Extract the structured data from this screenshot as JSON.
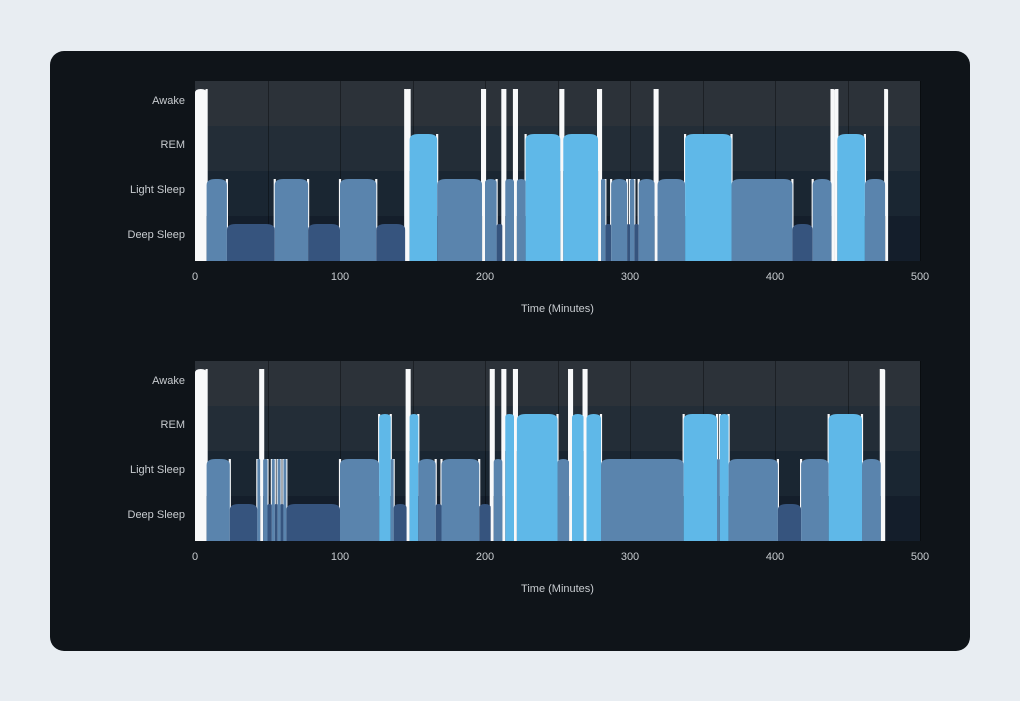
{
  "xlabel": "Time (Minutes)",
  "stages": [
    "Awake",
    "REM",
    "Light Sleep",
    "Deep Sleep"
  ],
  "xticks": [
    0,
    100,
    200,
    300,
    400,
    500
  ],
  "xmin": 0,
  "xmax": 500,
  "chart_data": [
    {
      "type": "hypnogram",
      "title": "",
      "xlabel": "Time (Minutes)",
      "ylabel": "",
      "categories": [
        "Awake",
        "REM",
        "Light Sleep",
        "Deep Sleep"
      ],
      "xlim": [
        0,
        500
      ],
      "segments": [
        {
          "start": 0,
          "end": 8,
          "stage": "Awake"
        },
        {
          "start": 8,
          "end": 22,
          "stage": "Light Sleep"
        },
        {
          "start": 22,
          "end": 55,
          "stage": "Deep Sleep"
        },
        {
          "start": 55,
          "end": 78,
          "stage": "Light Sleep"
        },
        {
          "start": 78,
          "end": 100,
          "stage": "Deep Sleep"
        },
        {
          "start": 100,
          "end": 125,
          "stage": "Light Sleep"
        },
        {
          "start": 125,
          "end": 145,
          "stage": "Deep Sleep"
        },
        {
          "start": 145,
          "end": 148,
          "stage": "Awake"
        },
        {
          "start": 148,
          "end": 167,
          "stage": "REM"
        },
        {
          "start": 167,
          "end": 198,
          "stage": "Light Sleep"
        },
        {
          "start": 198,
          "end": 200,
          "stage": "Awake"
        },
        {
          "start": 200,
          "end": 208,
          "stage": "Light Sleep"
        },
        {
          "start": 208,
          "end": 212,
          "stage": "Deep Sleep"
        },
        {
          "start": 212,
          "end": 214,
          "stage": "Awake"
        },
        {
          "start": 214,
          "end": 220,
          "stage": "Light Sleep"
        },
        {
          "start": 220,
          "end": 222,
          "stage": "Awake"
        },
        {
          "start": 222,
          "end": 228,
          "stage": "Light Sleep"
        },
        {
          "start": 228,
          "end": 252,
          "stage": "REM"
        },
        {
          "start": 252,
          "end": 254,
          "stage": "Awake"
        },
        {
          "start": 254,
          "end": 278,
          "stage": "REM"
        },
        {
          "start": 278,
          "end": 280,
          "stage": "Awake"
        },
        {
          "start": 280,
          "end": 283,
          "stage": "Light Sleep"
        },
        {
          "start": 283,
          "end": 287,
          "stage": "Deep Sleep"
        },
        {
          "start": 287,
          "end": 298,
          "stage": "Light Sleep"
        },
        {
          "start": 298,
          "end": 300,
          "stage": "Deep Sleep"
        },
        {
          "start": 300,
          "end": 303,
          "stage": "Light Sleep"
        },
        {
          "start": 303,
          "end": 306,
          "stage": "Deep Sleep"
        },
        {
          "start": 306,
          "end": 317,
          "stage": "Light Sleep"
        },
        {
          "start": 317,
          "end": 319,
          "stage": "Awake"
        },
        {
          "start": 319,
          "end": 338,
          "stage": "Light Sleep"
        },
        {
          "start": 338,
          "end": 370,
          "stage": "REM"
        },
        {
          "start": 370,
          "end": 412,
          "stage": "Light Sleep"
        },
        {
          "start": 412,
          "end": 426,
          "stage": "Deep Sleep"
        },
        {
          "start": 426,
          "end": 439,
          "stage": "Light Sleep"
        },
        {
          "start": 439,
          "end": 441,
          "stage": "Awake"
        },
        {
          "start": 441,
          "end": 443,
          "stage": "Awake"
        },
        {
          "start": 443,
          "end": 462,
          "stage": "REM"
        },
        {
          "start": 462,
          "end": 476,
          "stage": "Light Sleep"
        },
        {
          "start": 476,
          "end": 478,
          "stage": "Awake"
        }
      ]
    },
    {
      "type": "hypnogram",
      "title": "",
      "xlabel": "Time (Minutes)",
      "ylabel": "",
      "categories": [
        "Awake",
        "REM",
        "Light Sleep",
        "Deep Sleep"
      ],
      "xlim": [
        0,
        500
      ],
      "segments": [
        {
          "start": 0,
          "end": 8,
          "stage": "Awake"
        },
        {
          "start": 8,
          "end": 24,
          "stage": "Light Sleep"
        },
        {
          "start": 24,
          "end": 43,
          "stage": "Deep Sleep"
        },
        {
          "start": 43,
          "end": 45,
          "stage": "Light Sleep"
        },
        {
          "start": 45,
          "end": 47,
          "stage": "Awake"
        },
        {
          "start": 47,
          "end": 50,
          "stage": "Light Sleep"
        },
        {
          "start": 50,
          "end": 53,
          "stage": "Deep Sleep"
        },
        {
          "start": 53,
          "end": 55,
          "stage": "Light Sleep"
        },
        {
          "start": 55,
          "end": 57,
          "stage": "Deep Sleep"
        },
        {
          "start": 57,
          "end": 59,
          "stage": "Light Sleep"
        },
        {
          "start": 59,
          "end": 61,
          "stage": "Deep Sleep"
        },
        {
          "start": 61,
          "end": 63,
          "stage": "Light Sleep"
        },
        {
          "start": 63,
          "end": 100,
          "stage": "Deep Sleep"
        },
        {
          "start": 100,
          "end": 127,
          "stage": "Light Sleep"
        },
        {
          "start": 127,
          "end": 135,
          "stage": "REM"
        },
        {
          "start": 135,
          "end": 137,
          "stage": "Light Sleep"
        },
        {
          "start": 137,
          "end": 146,
          "stage": "Deep Sleep"
        },
        {
          "start": 146,
          "end": 148,
          "stage": "Awake"
        },
        {
          "start": 148,
          "end": 154,
          "stage": "REM"
        },
        {
          "start": 154,
          "end": 166,
          "stage": "Light Sleep"
        },
        {
          "start": 166,
          "end": 170,
          "stage": "Deep Sleep"
        },
        {
          "start": 170,
          "end": 196,
          "stage": "Light Sleep"
        },
        {
          "start": 196,
          "end": 204,
          "stage": "Deep Sleep"
        },
        {
          "start": 204,
          "end": 206,
          "stage": "Awake"
        },
        {
          "start": 206,
          "end": 212,
          "stage": "Light Sleep"
        },
        {
          "start": 212,
          "end": 214,
          "stage": "Awake"
        },
        {
          "start": 214,
          "end": 220,
          "stage": "REM"
        },
        {
          "start": 220,
          "end": 222,
          "stage": "Awake"
        },
        {
          "start": 222,
          "end": 250,
          "stage": "REM"
        },
        {
          "start": 250,
          "end": 258,
          "stage": "Light Sleep"
        },
        {
          "start": 258,
          "end": 260,
          "stage": "Awake"
        },
        {
          "start": 260,
          "end": 268,
          "stage": "REM"
        },
        {
          "start": 268,
          "end": 270,
          "stage": "Awake"
        },
        {
          "start": 270,
          "end": 280,
          "stage": "REM"
        },
        {
          "start": 280,
          "end": 337,
          "stage": "Light Sleep"
        },
        {
          "start": 337,
          "end": 360,
          "stage": "REM"
        },
        {
          "start": 360,
          "end": 362,
          "stage": "Light Sleep"
        },
        {
          "start": 362,
          "end": 368,
          "stage": "REM"
        },
        {
          "start": 368,
          "end": 402,
          "stage": "Light Sleep"
        },
        {
          "start": 402,
          "end": 418,
          "stage": "Deep Sleep"
        },
        {
          "start": 418,
          "end": 437,
          "stage": "Light Sleep"
        },
        {
          "start": 437,
          "end": 460,
          "stage": "REM"
        },
        {
          "start": 460,
          "end": 473,
          "stage": "Light Sleep"
        },
        {
          "start": 473,
          "end": 476,
          "stage": "Awake"
        }
      ]
    }
  ]
}
